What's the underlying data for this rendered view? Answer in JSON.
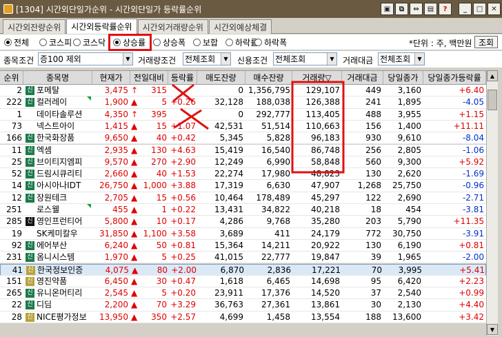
{
  "window": {
    "title": "[1304] 시간외단일가순위 - 시간외단일가 등락률순위"
  },
  "tabs": [
    {
      "label": "시간외잔량순위",
      "active": false
    },
    {
      "label": "시간외등락률순위",
      "active": true
    },
    {
      "label": "시간외거래량순위",
      "active": false
    },
    {
      "label": "시간외예상체결",
      "active": false
    }
  ],
  "market_options": [
    "전체",
    "코스피",
    "코스닥"
  ],
  "sort_options": [
    "상승률",
    "상승폭",
    "보합",
    "하락률",
    "하락폭"
  ],
  "selected": {
    "market": "전체",
    "sort": "상승률"
  },
  "unit_label": "*단위 : 주, 백만원",
  "inquiry_button": "조회",
  "filters": {
    "jongmok_label": "종목조건",
    "jongmok_value": "증100 제외",
    "volume_label": "거래량조건",
    "volume_value": "전체조회",
    "credit_label": "신용조건",
    "credit_value": "전체조회",
    "amount_label": "거래대금",
    "amount_value": "전체조회"
  },
  "columns": [
    "순위",
    "종목명",
    "현재가",
    "전일대비",
    "등락률",
    "매도잔량",
    "매수잔량",
    "거래량▽",
    "거래대금",
    "당일종가",
    "당일종가등락률"
  ],
  "rows": [
    {
      "rank": "2",
      "badge": "신",
      "name": "포메탈",
      "price": "3,475",
      "diff": "315",
      "dir": "up",
      "arrow": "↑",
      "rate": "",
      "sell": "0",
      "buy": "1,356,795",
      "vol": "129,107",
      "amt": "449",
      "close": "3,160",
      "close_rate": "+6.40",
      "cr_dir": "up",
      "tri": false
    },
    {
      "rank": "222",
      "badge": "신",
      "name": "컬러레이",
      "price": "1,900",
      "diff": "5",
      "dir": "up",
      "arrow": "▲",
      "rate": "+0.26",
      "sell": "32,128",
      "buy": "188,038",
      "vol": "126,388",
      "amt": "241",
      "close": "1,895",
      "close_rate": "-4.05",
      "cr_dir": "dn",
      "tri": true
    },
    {
      "rank": "1",
      "badge": "",
      "name": "데이타솔루션",
      "price": "4,350",
      "diff": "395",
      "dir": "up",
      "arrow": "↑",
      "rate": "",
      "sell": "0",
      "buy": "292,777",
      "vol": "113,405",
      "amt": "488",
      "close": "3,955",
      "close_rate": "+1.15",
      "cr_dir": "up",
      "tri": false
    },
    {
      "rank": "73",
      "badge": "",
      "name": "넥스트아이",
      "price": "1,415",
      "diff": "15",
      "dir": "up",
      "arrow": "▲",
      "rate": "+1.07",
      "sell": "42,531",
      "buy": "51,514",
      "vol": "110,663",
      "amt": "156",
      "close": "1,400",
      "close_rate": "+11.11",
      "cr_dir": "up",
      "tri": false
    },
    {
      "rank": "166",
      "badge": "신",
      "name": "한국화장품",
      "price": "9,650",
      "diff": "40",
      "dir": "up",
      "arrow": "▲",
      "rate": "+0.42",
      "sell": "5,345",
      "buy": "5,828",
      "vol": "96,183",
      "amt": "930",
      "close": "9,610",
      "close_rate": "-8.04",
      "cr_dir": "dn",
      "tri": false
    },
    {
      "rank": "11",
      "badge": "신",
      "name": "엑셈",
      "price": "2,935",
      "diff": "130",
      "dir": "up",
      "arrow": "▲",
      "rate": "+4.63",
      "sell": "15,419",
      "buy": "16,540",
      "vol": "86,748",
      "amt": "256",
      "close": "2,805",
      "close_rate": "-1.06",
      "cr_dir": "dn",
      "tri": false
    },
    {
      "rank": "25",
      "badge": "신",
      "name": "브이티지엠피",
      "price": "9,570",
      "diff": "270",
      "dir": "up",
      "arrow": "▲",
      "rate": "+2.90",
      "sell": "12,249",
      "buy": "6,990",
      "vol": "58,848",
      "amt": "560",
      "close": "9,300",
      "close_rate": "+5.92",
      "cr_dir": "up",
      "tri": false
    },
    {
      "rank": "52",
      "badge": "신",
      "name": "드림시큐리티",
      "price": "2,660",
      "diff": "40",
      "dir": "up",
      "arrow": "▲",
      "rate": "+1.53",
      "sell": "22,274",
      "buy": "17,980",
      "vol": "48,823",
      "amt": "130",
      "close": "2,620",
      "close_rate": "-1.69",
      "cr_dir": "dn",
      "tri": false
    },
    {
      "rank": "14",
      "badge": "신",
      "name": "아시아나IDT",
      "price": "26,750",
      "diff": "1,000",
      "dir": "up",
      "arrow": "▲",
      "rate": "+3.88",
      "sell": "17,319",
      "buy": "6,630",
      "vol": "47,907",
      "amt": "1,268",
      "close": "25,750",
      "close_rate": "-0.96",
      "cr_dir": "dn",
      "tri": false
    },
    {
      "rank": "12",
      "badge": "신",
      "name": "장원테크",
      "price": "2,705",
      "diff": "15",
      "dir": "up",
      "arrow": "▲",
      "rate": "+0.56",
      "sell": "10,464",
      "buy": "178,489",
      "vol": "45,297",
      "amt": "122",
      "close": "2,690",
      "close_rate": "-2.71",
      "cr_dir": "dn",
      "tri": false
    },
    {
      "rank": "251",
      "badge": "",
      "name": "로스웰",
      "price": "455",
      "diff": "1",
      "dir": "up",
      "arrow": "▲",
      "rate": "+0.22",
      "sell": "13,431",
      "buy": "34,822",
      "vol": "40,218",
      "amt": "18",
      "close": "454",
      "close_rate": "-3.81",
      "cr_dir": "dn",
      "tri": true
    },
    {
      "rank": "285",
      "badge": "신",
      "badge_style": "bk",
      "name": "영인프런티어",
      "price": "5,800",
      "diff": "10",
      "dir": "up",
      "arrow": "▲",
      "rate": "+0.17",
      "sell": "4,286",
      "buy": "9,768",
      "vol": "35,280",
      "amt": "203",
      "close": "5,790",
      "close_rate": "+11.35",
      "cr_dir": "up",
      "tri": false
    },
    {
      "rank": "19",
      "badge": "",
      "name": "SK케미칼우",
      "price": "31,850",
      "diff": "1,100",
      "dir": "up",
      "arrow": "▲",
      "rate": "+3.58",
      "sell": "3,689",
      "buy": "411",
      "vol": "24,179",
      "amt": "772",
      "close": "30,750",
      "close_rate": "-3.91",
      "cr_dir": "dn",
      "tri": false
    },
    {
      "rank": "92",
      "badge": "신",
      "name": "에어부산",
      "price": "6,240",
      "diff": "50",
      "dir": "up",
      "arrow": "▲",
      "rate": "+0.81",
      "sell": "15,364",
      "buy": "14,211",
      "vol": "20,922",
      "amt": "130",
      "close": "6,190",
      "close_rate": "+0.81",
      "cr_dir": "up",
      "tri": false
    },
    {
      "rank": "231",
      "badge": "신",
      "name": "옴니시스템",
      "price": "1,970",
      "diff": "5",
      "dir": "up",
      "arrow": "▲",
      "rate": "+0.25",
      "sell": "41,015",
      "buy": "22,777",
      "vol": "19,847",
      "amt": "39",
      "close": "1,965",
      "close_rate": "-2.00",
      "cr_dir": "dn",
      "tri": false
    },
    {
      "rank": "41",
      "badge": "신",
      "badge_style": "yl",
      "name": "한국정보인증",
      "price": "4,075",
      "diff": "80",
      "dir": "up",
      "arrow": "▲",
      "rate": "+2.00",
      "sell": "6,870",
      "buy": "2,836",
      "vol": "17,221",
      "amt": "70",
      "close": "3,995",
      "close_rate": "+5.41",
      "cr_dir": "up",
      "tri": false,
      "sel": true
    },
    {
      "rank": "151",
      "badge": "신",
      "badge_style": "yl",
      "name": "영진약품",
      "price": "6,450",
      "diff": "30",
      "dir": "up",
      "arrow": "▲",
      "rate": "+0.47",
      "sell": "1,618",
      "buy": "6,465",
      "vol": "14,698",
      "amt": "95",
      "close": "6,420",
      "close_rate": "+2.23",
      "cr_dir": "up",
      "tri": false
    },
    {
      "rank": "265",
      "badge": "신",
      "name": "유니온머티리",
      "price": "2,545",
      "diff": "5",
      "dir": "up",
      "arrow": "▲",
      "rate": "+0.20",
      "sell": "23,911",
      "buy": "17,376",
      "vol": "14,520",
      "amt": "37",
      "close": "2,540",
      "close_rate": "+0.99",
      "cr_dir": "up",
      "tri": false
    },
    {
      "rank": "22",
      "badge": "신",
      "name": "디딤",
      "price": "2,200",
      "diff": "70",
      "dir": "up",
      "arrow": "▲",
      "rate": "+3.29",
      "sell": "36,763",
      "buy": "27,361",
      "vol": "13,861",
      "amt": "30",
      "close": "2,130",
      "close_rate": "+4.40",
      "cr_dir": "up",
      "tri": false
    },
    {
      "rank": "28",
      "badge": "신",
      "badge_style": "yl",
      "name": "NICE평가정보",
      "price": "13,950",
      "diff": "350",
      "dir": "up",
      "arrow": "▲",
      "rate": "+2.57",
      "sell": "4,699",
      "buy": "1,458",
      "vol": "13,554",
      "amt": "188",
      "close": "13,600",
      "close_rate": "+3.42",
      "cr_dir": "up",
      "tri": false
    }
  ]
}
